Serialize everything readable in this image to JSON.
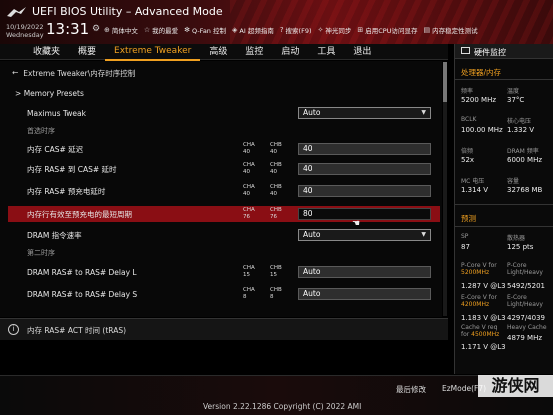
{
  "header": {
    "title": "UEFI BIOS Utility – Advanced Mode",
    "date_line1": "10/19/2022",
    "date_line2": "Wednesday",
    "time": "13:31",
    "tools": [
      {
        "icon": "globe-icon",
        "label": "简体中文"
      },
      {
        "icon": "star-icon",
        "label": "我的最爱"
      },
      {
        "icon": "fan-icon",
        "label": "Q-Fan 控制"
      },
      {
        "icon": "ai-icon",
        "label": "AI 超频指南"
      },
      {
        "icon": "question-icon",
        "label": "搜索(F9)"
      },
      {
        "icon": "sparkle-icon",
        "label": "神光同步"
      },
      {
        "icon": "network-icon",
        "label": "启用CPU访问显存"
      },
      {
        "icon": "memtest-icon",
        "label": "内存稳定性测试"
      }
    ]
  },
  "nav": {
    "items": [
      "收藏夹",
      "概要",
      "Extreme Tweaker",
      "高级",
      "监控",
      "启动",
      "工具",
      "退出"
    ],
    "active_index": 2
  },
  "content": {
    "breadcrumb": "Extreme Tweaker\\内存时序控制",
    "memory_presets": "Memory Presets",
    "maximus_tweak_label": "Maximus Tweak",
    "maximus_tweak_value": "Auto",
    "section_primary": "首选时序",
    "cas_label": "内存 CAS# 延迟",
    "cas_cha_label": "CHA",
    "cas_cha_value": "40",
    "cas_chb_label": "CHB",
    "cas_chb_value": "40",
    "cas_value": "40",
    "rcd_label": "内存 RAS# 到 CAS# 延时",
    "rcd_cha_label": "CHA",
    "rcd_cha_value": "40",
    "rcd_chb_label": "CHB",
    "rcd_chb_value": "40",
    "rcd_value": "40",
    "rp_label": "内存 RAS# 预充电延时",
    "rp_cha_label": "CHA",
    "rp_cha_value": "40",
    "rp_chb_label": "CHB",
    "rp_chb_value": "40",
    "rp_value": "40",
    "ras_label": "内存行有效至预充电的最短周期",
    "ras_cha_label": "CHA",
    "ras_cha_value": "76",
    "ras_chb_label": "CHB",
    "ras_chb_value": "76",
    "ras_value": "80",
    "cmd_label": "DRAM 指令速率",
    "cmd_value": "Auto",
    "section_secondary": "第二时序",
    "rrdl_label": "DRAM RAS# to RAS# Delay L",
    "rrdl_cha_label": "CHA",
    "rrdl_cha_value": "15",
    "rrdl_chb_label": "CHB",
    "rrdl_chb_value": "15",
    "rrdl_value": "Auto",
    "rrds_label": "DRAM RAS# to RAS# Delay S",
    "rrds_cha_label": "CHA",
    "rrds_cha_value": "8",
    "rrds_chb_label": "CHB",
    "rrds_chb_value": "8",
    "rrds_value": "Auto"
  },
  "info": {
    "text": "内存 RAS# ACT 时间 (tRAS)"
  },
  "hw_monitor": {
    "title": "硬件监控",
    "cpu_mem_title": "处理器/内存",
    "freq_label": "频率",
    "freq_value": "5200 MHz",
    "temp_label": "温度",
    "temp_value": "37°C",
    "bclk_label": "BCLK",
    "bclk_value": "100.00 MHz",
    "vcore_label": "核心电压",
    "vcore_value": "1.332 V",
    "ratio_label": "倍频",
    "ratio_value": "52x",
    "dram_label": "DRAM 频率",
    "dram_value": "6000 MHz",
    "mc_label": "MC 电压",
    "mc_value": "1.314 V",
    "cap_label": "容量",
    "cap_value": "32768 MB",
    "predict_title": "预测",
    "sp_label": "SP",
    "sp_value": "87",
    "cooler_label": "散热器",
    "cooler_value": "125 pts",
    "pcore_v_label1": "P-Core V for",
    "pcore_v_label2": "5200MHz",
    "pcore_lh_label1": "P-Core",
    "pcore_lh_label2": "Light/Heavy",
    "pcore_v_value": "1.287 V @L3",
    "pcore_lh_value": "5492/5201",
    "ecore_v_label1": "E-Core V for",
    "ecore_v_label2": "4200MHz",
    "ecore_lh_label1": "E-Core",
    "ecore_lh_label2": "Light/Heavy",
    "ecore_v_value": "1.183 V @L3",
    "ecore_lh_value": "4297/4039",
    "cache_v_label1": "Cache V req",
    "cache_v_label2": "for",
    "cache_v_label3": "4500MHz",
    "heavy_cache_label": "Heavy Cache",
    "heavy_cache_value": "4879 MHz",
    "cache_v_value": "1.171 V @L3"
  },
  "footer": {
    "last_modified": "最后修改",
    "ezmode": "EzMode(F7)",
    "version": "Version 2.22.1286 Copyright (C) 2022 AMI"
  },
  "watermark": "游侠网",
  "colors": {
    "accent": "#f0a020",
    "selected_row": "#8a0e14",
    "header_red": "#6b0f12"
  }
}
